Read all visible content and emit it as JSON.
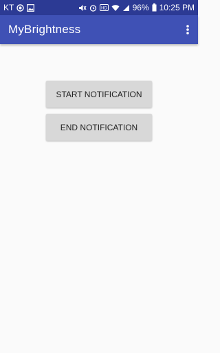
{
  "status_bar": {
    "carrier": "KT",
    "battery_percent": "96%",
    "time": "10:25 PM",
    "icons": [
      "notification-dot-icon",
      "image-icon",
      "mute-icon",
      "alarm-icon",
      "hd-icon",
      "wifi-icon",
      "signal-icon",
      "battery-icon"
    ]
  },
  "app_bar": {
    "title": "MyBrightness",
    "overflow_icon": "more-vert-icon",
    "color": "#3f51b5"
  },
  "main": {
    "start_label": "START NOTIFICATION",
    "end_label": "END NOTIFICATION"
  }
}
